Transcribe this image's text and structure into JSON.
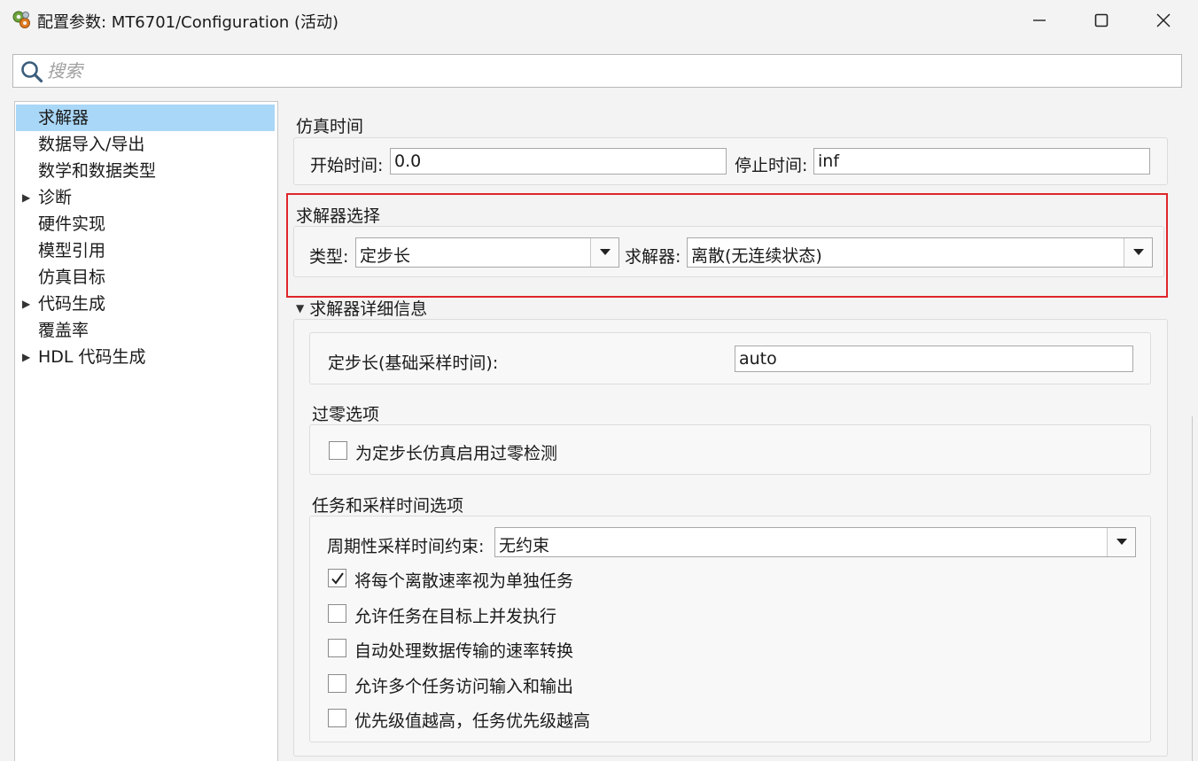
{
  "window": {
    "title": "配置参数: MT6701/Configuration (活动)",
    "icon": "gear-cluster-icon",
    "controls": [
      "minimize",
      "maximize",
      "close"
    ]
  },
  "search": {
    "placeholder": "搜索"
  },
  "nav": {
    "items": [
      {
        "label": "求解器",
        "expandable": false,
        "selected": true
      },
      {
        "label": "数据导入/导出",
        "expandable": false,
        "selected": false
      },
      {
        "label": "数学和数据类型",
        "expandable": false,
        "selected": false
      },
      {
        "label": "诊断",
        "expandable": true,
        "selected": false
      },
      {
        "label": "硬件实现",
        "expandable": false,
        "selected": false
      },
      {
        "label": "模型引用",
        "expandable": false,
        "selected": false
      },
      {
        "label": "仿真目标",
        "expandable": false,
        "selected": false
      },
      {
        "label": "代码生成",
        "expandable": true,
        "selected": false
      },
      {
        "label": "覆盖率",
        "expandable": false,
        "selected": false
      },
      {
        "label": "HDL 代码生成",
        "expandable": true,
        "selected": false
      }
    ]
  },
  "sim_time": {
    "title": "仿真时间",
    "start_label": "开始时间:",
    "start_value": "0.0",
    "stop_label": "停止时间:",
    "stop_value": "inf"
  },
  "solver_select": {
    "title": "求解器选择",
    "type_label": "类型:",
    "type_value": "定步长",
    "solver_label": "求解器:",
    "solver_value": "离散(无连续状态)",
    "highlight_color": "#e0252b"
  },
  "solver_details": {
    "title": "求解器详细信息",
    "expanded": true,
    "step_label": "定步长(基础采样时间):",
    "step_value": "auto"
  },
  "zero_crossing": {
    "title": "过零选项",
    "checkbox_label": "为定步长仿真启用过零检测",
    "checked": false
  },
  "tasks": {
    "title": "任务和采样时间选项",
    "constraint_label": "周期性采样时间约束:",
    "constraint_value": "无约束",
    "options": [
      {
        "label": "将每个离散速率视为单独任务",
        "checked": true
      },
      {
        "label": "允许任务在目标上并发执行",
        "checked": false
      },
      {
        "label": "自动处理数据传输的速率转换",
        "checked": false
      },
      {
        "label": "允许多个任务访问输入和输出",
        "checked": false
      },
      {
        "label": "优先级值越高，任务优先级越高",
        "checked": false
      }
    ]
  }
}
